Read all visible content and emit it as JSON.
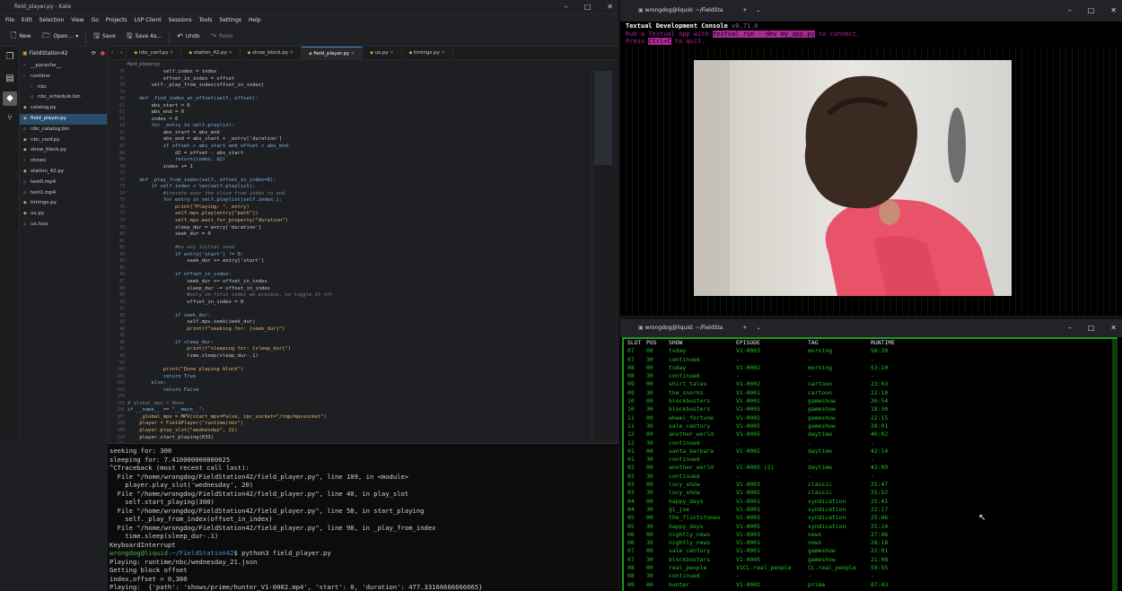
{
  "kate": {
    "window_title": "field_player.py - Kate",
    "menu": [
      "File",
      "Edit",
      "Selection",
      "View",
      "Go",
      "Projects",
      "LSP Client",
      "Sessions",
      "Tools",
      "Settings",
      "Help"
    ],
    "toolbar": {
      "new": "New",
      "open": "Open...",
      "save": "Save",
      "save_as": "Save As...",
      "undo": "Undo",
      "redo": "Redo"
    },
    "project": "FieldStation42",
    "files": [
      {
        "name": "__pycache__",
        "type": "folder",
        "level": 0
      },
      {
        "name": "runtime",
        "type": "folder",
        "level": 0
      },
      {
        "name": "nbc",
        "type": "folder",
        "level": 1
      },
      {
        "name": "nbc_schedule.bin",
        "type": "file",
        "level": 1
      },
      {
        "name": "catalog.py",
        "type": "py",
        "level": 0
      },
      {
        "name": "field_player.py",
        "type": "py",
        "level": 0,
        "selected": true
      },
      {
        "name": "nbc_catalog.bin",
        "type": "file",
        "level": 0
      },
      {
        "name": "nbc_conf.py",
        "type": "py",
        "level": 0
      },
      {
        "name": "show_block.py",
        "type": "py",
        "level": 0
      },
      {
        "name": "shows",
        "type": "folder",
        "level": 0
      },
      {
        "name": "station_42.py",
        "type": "py",
        "level": 0
      },
      {
        "name": "test0.mp4",
        "type": "file",
        "level": 0
      },
      {
        "name": "test1.mp4",
        "type": "file",
        "level": 0
      },
      {
        "name": "timings.py",
        "type": "py",
        "level": 0
      },
      {
        "name": "ux.py",
        "type": "py",
        "level": 0
      },
      {
        "name": "ux.tcss",
        "type": "file",
        "level": 0
      }
    ],
    "tabs": [
      "nbc_conf.py",
      "station_42.py",
      "show_block.py",
      "field_player.py",
      "ux.py",
      "timings.py"
    ],
    "active_tab": "field_player.py",
    "breadcrumb": "field_player.py",
    "line_start": 56,
    "code": [
      "            self.index = index",
      "            offset_in_index = offset",
      "        self._play_from_index(offset_in_index)",
      "",
      "    def _find_index_at_offset(self, offset):",
      "        abs_start = 0",
      "        abs_end = 0",
      "        index = 0",
      "        for _entry in self.playlist:",
      "            abs_start = abs_end",
      "            abs_end = abs_start + _entry['duration']",
      "            if offset > abs_start and offset < abs_end:",
      "                d2 = offset - abs_start",
      "                return(index, d2)",
      "            index += 1",
      "",
      "    def _play_from_index(self, offset_in_index=0):",
      "        if self.index < len(self.playlist):",
      "            #iterate over the slice from index to end",
      "            for entry in self.playlist[self.index:]:",
      "                print(\"Playing: \", entry)",
      "                self.mpv.play(entry[\"path\"])",
      "                self.mpv.wait_for_property(\"duration\")",
      "                sleep_dur = entry['duration']",
      "                seek_dur = 0",
      "",
      "                #do any initial seed",
      "                if entry['start'] != 0:",
      "                    seek_dur += entry['start']",
      "",
      "                if offset_in_index:",
      "                    seek_dur += offset_in_index",
      "                    sleep_dur -= offset_in_index",
      "                    #only on first index we process, so toggle it off",
      "                    offset_in_index = 0",
      "",
      "                if seek_dur:",
      "                    self.mpv.seek(seek_dur)",
      "                    print(f\"seeking for: {seek_dur}\")",
      "",
      "                if sleep_dur:",
      "                    print(f\"sleeping for: {sleep_dur}\")",
      "                    time.sleep(sleep_dur-.1)",
      "",
      "            print(\"Done playing block\")",
      "            return True",
      "        else:",
      "            return False",
      "",
      "# global_mpv = None",
      "if __name__ == \"__main__\":",
      "    _global_mpv = MPV(start_mpv=False, ipc_socket=\"/tmp/mpvsocket\")",
      "    player = FieldPlayer(\"runtime/nbc\")",
      "    player.play_slot(\"wednesday\", 21)",
      "    player.start_playing(633)",
      ""
    ],
    "terminal": [
      "seeking for: 300",
      "sleeping for: 7.410000000000025",
      "^CTraceback (most recent call last):",
      "  File \"/home/wrongdog/FieldStation42/field_player.py\", line 109, in <module>",
      "    player.play_slot('wednesday', 20)",
      "  File \"/home/wrongdog/FieldStation42/field_player.py\", line 40, in play_slot",
      "    self.start_playing(300)",
      "  File \"/home/wrongdog/FieldStation42/field_player.py\", line 58, in start_playing",
      "    self._play_from_index(offset_in_index)",
      "  File \"/home/wrongdog/FieldStation42/field_player.py\", line 98, in _play_from_index",
      "    time.sleep(sleep_dur-.1)",
      "KeyboardInterrupt",
      "",
      "Playing: runtime/nbc/wednesday_21.json",
      "Getting block offset",
      "index,offset = 0,300",
      "Playing:  {'path': 'shows/prime/hunter_V1-0002.mp4', 'start': 0, 'duration': 477.33166666666665}"
    ],
    "prompt": {
      "user": "wrongdog@liquid",
      "path": ":~/FieldStation42",
      "cmd": "$ python3 field_player.py"
    }
  },
  "console": {
    "window_title": "wrongdog@liquid: ~/FieldSta",
    "heading": "Textual Development Console",
    "version": "v0.71.0",
    "run_pre": "Run a Textual app with",
    "run_cmd": "textual run --dev my_app.py",
    "run_post": "to connect.",
    "press": "Press",
    "key": "Ctrl+C",
    "quit": "to quit."
  },
  "table_window": {
    "window_title": "wrongdog@liquid: ~/FieldSta",
    "columns": [
      "SLOT",
      "POS",
      "SHOW",
      "EPISODE",
      "TAG",
      "RUNTIME"
    ],
    "rows": [
      [
        "07",
        "00",
        "today",
        "V1-0003",
        "morning",
        "58:20"
      ],
      [
        "07",
        "30",
        "continued",
        "-",
        "-",
        "-"
      ],
      [
        "08",
        "00",
        "today",
        "V1-0002",
        "morning",
        "53:10"
      ],
      [
        "08",
        "30",
        "continued",
        "-",
        "-",
        "-"
      ],
      [
        "09",
        "00",
        "shirt_tales",
        "V1-0002",
        "cartoon",
        "23:03"
      ],
      [
        "09",
        "30",
        "the_snorks",
        "V1-0001",
        "cartoon",
        "22:10"
      ],
      [
        "10",
        "00",
        "blockbusters",
        "V1-0002",
        "gameshow",
        "20:54"
      ],
      [
        "10",
        "30",
        "blockbusters",
        "V1-0003",
        "gameshow",
        "18:30"
      ],
      [
        "11",
        "00",
        "wheel_fortune",
        "V1-0002",
        "gameshow",
        "22:15"
      ],
      [
        "11",
        "30",
        "sale_century",
        "V1-0005",
        "gameshow",
        "28:01"
      ],
      [
        "12",
        "00",
        "another_world",
        "V1-0005",
        "daytime",
        "40:02"
      ],
      [
        "12",
        "30",
        "continued",
        "-",
        "-",
        "-"
      ],
      [
        "01",
        "00",
        "santa_barbara",
        "V1-0002",
        "daytime",
        "42:14"
      ],
      [
        "01",
        "30",
        "continued",
        "-",
        "-",
        "-"
      ],
      [
        "02",
        "00",
        "another_world",
        "V1-0005 (2)",
        "daytime",
        "43:09"
      ],
      [
        "02",
        "30",
        "continued",
        "-",
        "-",
        "-"
      ],
      [
        "03",
        "00",
        "lucy_show",
        "V1-0003",
        "classic",
        "25:47"
      ],
      [
        "03",
        "30",
        "lucy_show",
        "V1-0002",
        "classic",
        "25:52"
      ],
      [
        "04",
        "00",
        "happy_days",
        "V1-0001",
        "syndication",
        "25:41"
      ],
      [
        "04",
        "30",
        "gi_joe",
        "V1-0001",
        "syndication",
        "22:17"
      ],
      [
        "05",
        "00",
        "the_flintstones",
        "V1-0003",
        "syndication",
        "25:06"
      ],
      [
        "05",
        "30",
        "happy_days",
        "V1-0005",
        "syndication",
        "25:24"
      ],
      [
        "06",
        "00",
        "nightly_news",
        "V1-0003",
        "news",
        "27:46"
      ],
      [
        "06",
        "30",
        "nightly_news",
        "V1-0001",
        "news",
        "28:18"
      ],
      [
        "07",
        "00",
        "sale_century",
        "V1-0001",
        "gameshow",
        "22:01"
      ],
      [
        "07",
        "30",
        "blockbusters",
        "V1-0005",
        "gameshow",
        "21:08"
      ],
      [
        "08",
        "00",
        "real_people",
        "V1CL.real_people",
        "CL.real_people",
        "59:55"
      ],
      [
        "08",
        "30",
        "continued",
        "-",
        "-",
        "-"
      ],
      [
        "09",
        "00",
        "hunter",
        "V1-0002",
        "prime",
        "07:43"
      ]
    ]
  }
}
